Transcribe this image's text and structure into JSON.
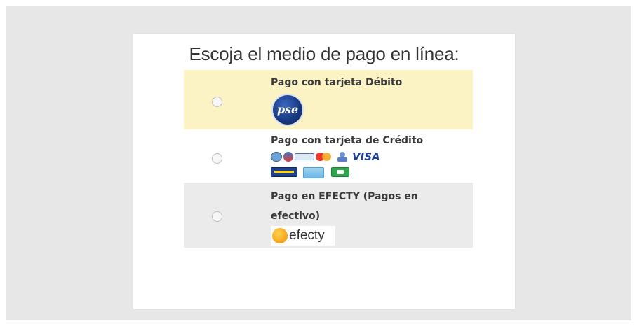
{
  "title": "Escoja el medio de pago en línea:",
  "options": [
    {
      "label": "Pago con tarjeta Débito",
      "logo_text": "pse",
      "icon": "pse-logo-icon"
    },
    {
      "label": "Pago con tarjeta de Crédito",
      "logo_text": "VISA",
      "icon": "credit-card-logos-icon"
    },
    {
      "label": "Pago en EFECTY (Pagos en efectivo)",
      "logo_text": "efecty",
      "icon": "efecty-logo-icon"
    }
  ],
  "colors": {
    "highlight_row": "#fbf3c3",
    "alt_row": "#ebebeb",
    "backdrop": "#e7e7e7"
  }
}
